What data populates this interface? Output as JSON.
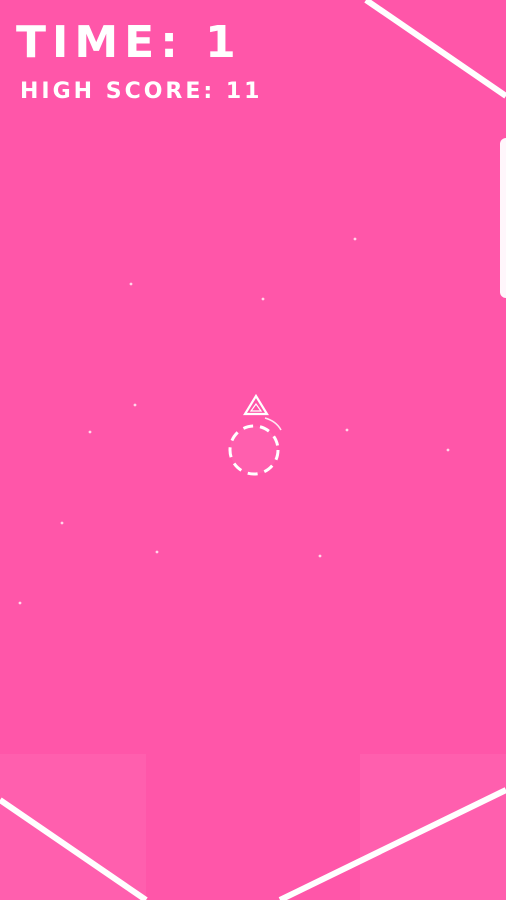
{
  "hud": {
    "time_label": "TIME: 1",
    "high_score_label": "HIGH SCORE: 11"
  },
  "colors": {
    "background": "#ff56a9",
    "foreground": "#ffffff"
  },
  "icons": {
    "player": "triangle-ship-icon",
    "target": "dashed-circle-icon"
  }
}
